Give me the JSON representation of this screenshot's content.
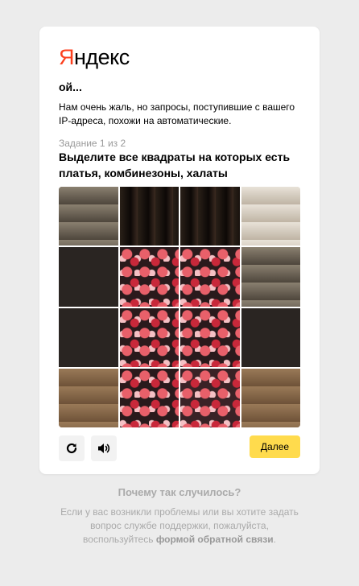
{
  "logo": {
    "first": "Я",
    "rest": "ндекс"
  },
  "oops": "ой...",
  "message": "Нам очень жаль, но запросы, поступившие с вашего IP-адреса, похожи на автоматические.",
  "task_number": "Задание 1 из 2",
  "task_text": "Выделите все квадраты на которых есть платья, комбинезоны, халаты",
  "tiles": [
    "bg-room",
    "bg-hair",
    "bg-hair",
    "bg-light",
    "bg-dark",
    "bg-dress",
    "bg-dress",
    "bg-room",
    "bg-dark",
    "bg-dress",
    "bg-dress",
    "bg-dark",
    "bg-floor",
    "bg-dress",
    "bg-mixdress",
    "bg-floor"
  ],
  "controls": {
    "refresh_icon": "refresh-icon",
    "audio_icon": "speaker-icon",
    "next_label": "Далее"
  },
  "footer": {
    "why_title": "Почему так случилось?",
    "help_text": "Если у вас возникли проблемы или вы хотите задать вопрос службе поддержки, пожалуйста, воспользуйтесь ",
    "help_link": "формой обратной связи",
    "help_end": "."
  },
  "colors": {
    "accent": "#ffdb4d",
    "logo_red": "#fc3f1d",
    "background": "#ececec"
  }
}
